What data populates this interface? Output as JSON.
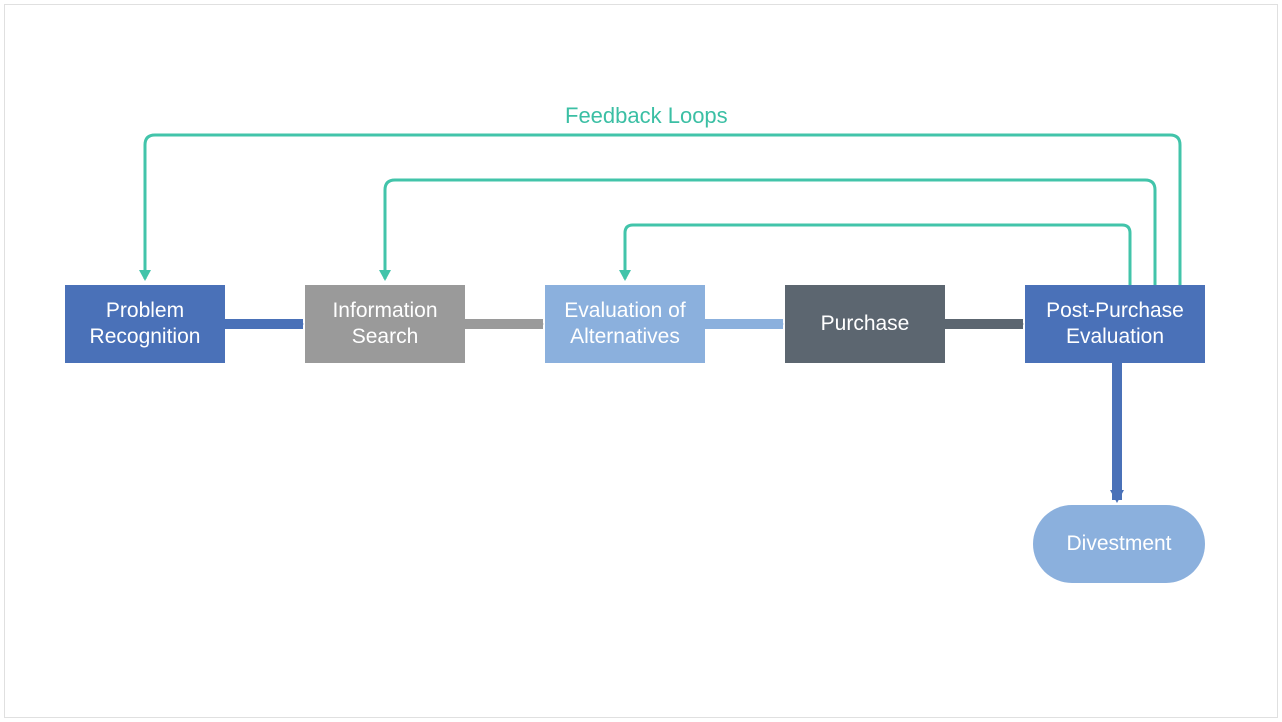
{
  "diagram": {
    "feedback_label": "Feedback Loops",
    "colors": {
      "blue": "#4a71b8",
      "gray": "#9a9a9a",
      "lightblue": "#8bb0dd",
      "darkgray": "#5c6670",
      "teal": "#42c4aa",
      "pillblue": "#8bb0dd"
    },
    "nodes": {
      "n1": {
        "label": "Problem\nRecognition"
      },
      "n2": {
        "label": "Information\nSearch"
      },
      "n3": {
        "label": "Evaluation of\nAlternatives"
      },
      "n4": {
        "label": "Purchase"
      },
      "n5": {
        "label": "Post-Purchase\nEvaluation"
      },
      "n6": {
        "label": "Divestment"
      }
    }
  }
}
